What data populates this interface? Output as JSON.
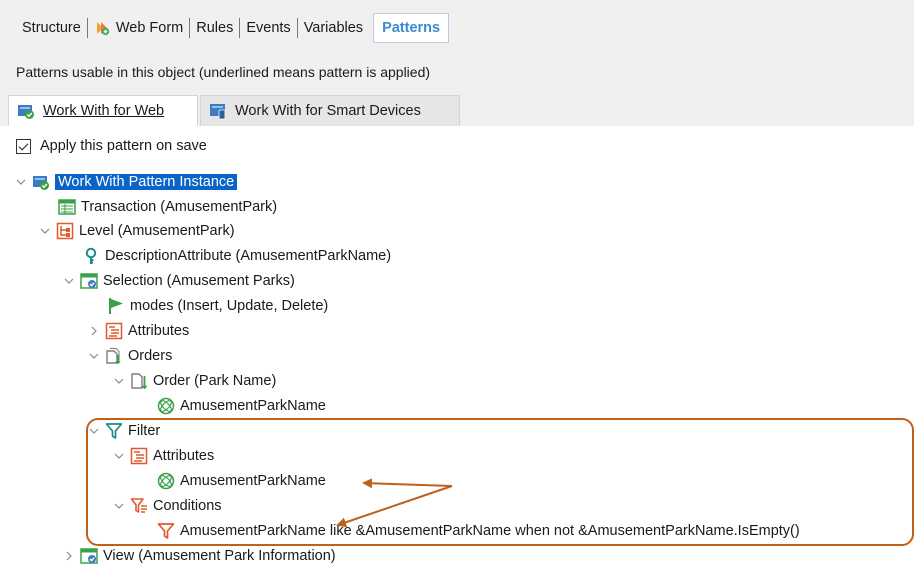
{
  "top_tabs": [
    {
      "label": "Structure",
      "icon": ""
    },
    {
      "label": "Web Form",
      "icon": "web-form-icon"
    },
    {
      "label": "Rules",
      "icon": ""
    },
    {
      "label": "Events",
      "icon": ""
    },
    {
      "label": "Variables",
      "icon": ""
    },
    {
      "label": "Patterns",
      "icon": "",
      "active": true
    }
  ],
  "info_text": "Patterns usable in this object (underlined means pattern is applied)",
  "sub_tabs": [
    {
      "label": "Work With for Web",
      "active": true
    },
    {
      "label": "Work With for Smart Devices",
      "active": false
    }
  ],
  "apply_checkbox": {
    "label": "Apply this pattern on save",
    "checked": true
  },
  "tree": {
    "root": "Work With Pattern Instance",
    "transaction": "Transaction (AmusementPark)",
    "level": "Level (AmusementPark)",
    "description_attribute": "DescriptionAttribute (AmusementParkName)",
    "selection": "Selection (Amusement Parks)",
    "modes": "modes (Insert, Update, Delete)",
    "attributes": "Attributes",
    "orders": "Orders",
    "order": "Order (Park Name)",
    "order_attr": "AmusementParkName",
    "filter": "Filter",
    "filter_attributes": "Attributes",
    "filter_attr": "AmusementParkName",
    "conditions": "Conditions",
    "condition": "AmusementParkName like &AmusementParkName when  not &AmusementParkName.IsEmpty()",
    "view": "View (Amusement Park Information)"
  },
  "colors": {
    "accent_tab": "#3a8bd0",
    "selection": "#0a64c8",
    "annotation": "#c0601a"
  }
}
